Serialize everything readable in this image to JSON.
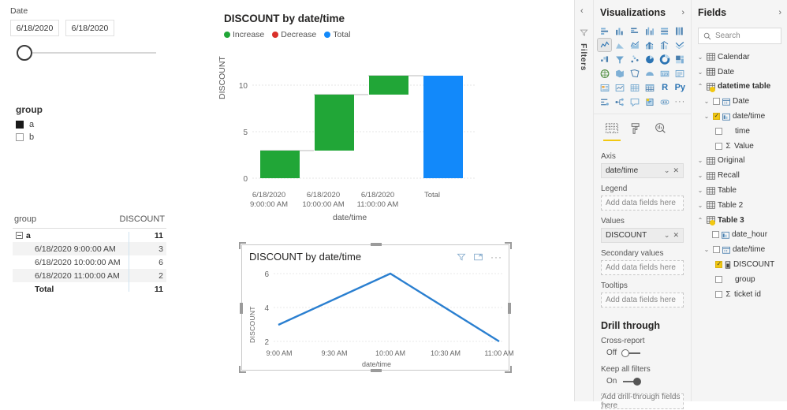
{
  "canvas": {
    "date_slicer": {
      "title": "Date",
      "start": "6/18/2020",
      "end": "6/18/2020"
    },
    "group_slicer": {
      "title": "group",
      "items": [
        {
          "label": "a",
          "checked": true
        },
        {
          "label": "b",
          "checked": false
        }
      ]
    },
    "matrix": {
      "columns": [
        "group",
        "DISCOUNT"
      ],
      "rows": [
        {
          "label": "a",
          "value": "11",
          "level": 0,
          "bold": true,
          "expander": true
        },
        {
          "label": "6/18/2020 9:00:00 AM",
          "value": "3",
          "level": 1,
          "bold": false,
          "expander": false
        },
        {
          "label": "6/18/2020 10:00:00 AM",
          "value": "6",
          "level": 1,
          "bold": false,
          "expander": false
        },
        {
          "label": "6/18/2020 11:00:00 AM",
          "value": "2",
          "level": 1,
          "bold": false,
          "expander": false
        },
        {
          "label": "Total",
          "value": "11",
          "level": 1,
          "bold": true,
          "expander": false
        }
      ]
    }
  },
  "chart_data": [
    {
      "type": "bar",
      "subtype": "waterfall",
      "title": "DISCOUNT by date/time",
      "xlabel": "date/time",
      "ylabel": "DISCOUNT",
      "ylim": [
        0,
        11
      ],
      "yticks": [
        "0",
        "5",
        "10"
      ],
      "grid": true,
      "legend": [
        {
          "label": "Increase",
          "color": "#21A637"
        },
        {
          "label": "Decrease",
          "color": "#D9302A"
        },
        {
          "label": "Total",
          "color": "#1289FA"
        }
      ],
      "categories": [
        "6/18/2020\n9:00:00 AM",
        "6/18/2020\n10:00:00 AM",
        "6/18/2020\n11:00:00 AM",
        "Total"
      ],
      "category_lines": [
        [
          "6/18/2020",
          "9:00:00 AM"
        ],
        [
          "6/18/2020",
          "10:00:00 AM"
        ],
        [
          "6/18/2020",
          "11:00:00 AM"
        ],
        [
          "Total",
          ""
        ]
      ],
      "bars": [
        {
          "category": "6/18/2020 9:00:00 AM",
          "base": 0,
          "top": 3,
          "delta": 3,
          "kind": "Increase",
          "color": "#21A637"
        },
        {
          "category": "6/18/2020 10:00:00 AM",
          "base": 3,
          "top": 9,
          "delta": 6,
          "kind": "Increase",
          "color": "#21A637"
        },
        {
          "category": "6/18/2020 11:00:00 AM",
          "base": 9,
          "top": 11,
          "delta": 2,
          "kind": "Increase",
          "color": "#21A637"
        },
        {
          "category": "Total",
          "base": 0,
          "top": 11,
          "delta": 11,
          "kind": "Total",
          "color": "#1289FA"
        }
      ]
    },
    {
      "type": "line",
      "title": "DISCOUNT by date/time",
      "xlabel": "date/time",
      "ylabel": "DISCOUNT",
      "ylim": [
        2,
        6
      ],
      "yticks": [
        "2",
        "4",
        "6"
      ],
      "xticks": [
        "9:00 AM",
        "9:30 AM",
        "10:00 AM",
        "10:30 AM",
        "11:00 AM"
      ],
      "grid": true,
      "line_color": "#2A7FD0",
      "series": [
        {
          "name": "DISCOUNT",
          "points": [
            {
              "x": "9:00 AM",
              "y": 3
            },
            {
              "x": "10:00 AM",
              "y": 6
            },
            {
              "x": "11:00 AM",
              "y": 2
            }
          ]
        }
      ],
      "header_icons": [
        "filter-icon",
        "focus-mode-icon",
        "more-options-icon"
      ]
    }
  ],
  "right_rail": {
    "filters_tab": {
      "label": "Filters",
      "icon": "filter-icon",
      "collapse_icon": "chevron-left-icon"
    },
    "visualizations": {
      "title": "Visualizations",
      "expand_icon": "chevron-right-icon",
      "icons": [
        "stacked-bar-chart-icon",
        "stacked-column-chart-icon",
        "clustered-bar-chart-icon",
        "clustered-column-chart-icon",
        "100-stacked-bar-chart-icon",
        "100-stacked-column-chart-icon",
        "line-chart-icon",
        "area-chart-icon",
        "stacked-area-chart-icon",
        "line-stacked-column-chart-icon",
        "line-clustered-column-chart-icon",
        "ribbon-chart-icon",
        "waterfall-chart-icon",
        "funnel-chart-icon",
        "scatter-chart-icon",
        "pie-chart-icon",
        "donut-chart-icon",
        "treemap-icon",
        "map-icon",
        "filled-map-icon",
        "shape-map-icon",
        "arcgis-map-icon",
        "gauge-icon",
        "card-icon",
        "multi-row-card-icon",
        "kpi-icon",
        "slicer-icon",
        "table-icon",
        "matrix-icon",
        "r-script-visual-icon",
        "py-script-visual-icon",
        "key-influencers-icon",
        "decomposition-tree-icon",
        "qa-icon",
        "smart-narrative-icon",
        "paginated-report-icon",
        "more-visuals-icon"
      ],
      "selected_icon": "line-chart-icon",
      "r_label": "R",
      "py_label": "Py",
      "tabs": [
        {
          "name": "fields-tab",
          "icon": "fields-grid-icon",
          "active": true
        },
        {
          "name": "format-tab",
          "icon": "paint-roller-icon",
          "active": false
        },
        {
          "name": "analytics-tab",
          "icon": "magnifier-chart-icon",
          "active": false
        }
      ],
      "wells": [
        {
          "label": "Axis",
          "value": "date/time",
          "filled": true,
          "placeholder": ""
        },
        {
          "label": "Legend",
          "value": "",
          "filled": false,
          "placeholder": "Add data fields here"
        },
        {
          "label": "Values",
          "value": "DISCOUNT",
          "filled": true,
          "placeholder": ""
        },
        {
          "label": "Secondary values",
          "value": "",
          "filled": false,
          "placeholder": "Add data fields here"
        },
        {
          "label": "Tooltips",
          "value": "",
          "filled": false,
          "placeholder": "Add data fields here"
        }
      ],
      "drill_through": {
        "title": "Drill through",
        "cross_report": {
          "label": "Cross-report",
          "state": "Off",
          "on": false
        },
        "keep_all_filters": {
          "label": "Keep all filters",
          "state": "On",
          "on": true
        },
        "drop_zone": "Add drill-through fields here"
      }
    },
    "fields": {
      "title": "Fields",
      "expand_icon": "chevron-right-icon",
      "search_placeholder": "Search",
      "search_icon": "search-icon",
      "tree": [
        {
          "label": "Calendar",
          "level": 0,
          "type": "table",
          "expanded": false,
          "checkbox": false,
          "checked": false,
          "bold": false
        },
        {
          "label": "Date",
          "level": 0,
          "type": "table",
          "expanded": false,
          "checkbox": false,
          "checked": false,
          "bold": false
        },
        {
          "label": "datetime table",
          "level": 0,
          "type": "table-key",
          "expanded": true,
          "checkbox": false,
          "checked": false,
          "bold": true
        },
        {
          "label": "Date",
          "level": 1,
          "type": "date-hierarchy",
          "expanded": false,
          "checkbox": true,
          "checked": false,
          "bold": false
        },
        {
          "label": "date/time",
          "level": 1,
          "type": "datetime-field",
          "expanded": false,
          "checkbox": true,
          "checked": true,
          "bold": false
        },
        {
          "label": "time",
          "level": 2,
          "type": "plain",
          "expanded": null,
          "checkbox": true,
          "checked": false,
          "bold": false
        },
        {
          "label": "Value",
          "level": 2,
          "type": "measure",
          "expanded": null,
          "checkbox": true,
          "checked": false,
          "bold": false
        },
        {
          "label": "Original",
          "level": 0,
          "type": "table",
          "expanded": false,
          "checkbox": false,
          "checked": false,
          "bold": false
        },
        {
          "label": "Recall",
          "level": 0,
          "type": "table",
          "expanded": false,
          "checkbox": false,
          "checked": false,
          "bold": false
        },
        {
          "label": "Table",
          "level": 0,
          "type": "table",
          "expanded": false,
          "checkbox": false,
          "checked": false,
          "bold": false
        },
        {
          "label": "Table 2",
          "level": 0,
          "type": "table",
          "expanded": false,
          "checkbox": false,
          "checked": false,
          "bold": false
        },
        {
          "label": "Table 3",
          "level": 0,
          "type": "table-key",
          "expanded": true,
          "checkbox": false,
          "checked": false,
          "bold": true
        },
        {
          "label": "date_hour",
          "level": 1,
          "type": "datetime-field",
          "expanded": null,
          "checkbox": true,
          "checked": false,
          "bold": false
        },
        {
          "label": "date/time",
          "level": 1,
          "type": "date-hierarchy",
          "expanded": false,
          "checkbox": true,
          "checked": false,
          "bold": false
        },
        {
          "label": "DISCOUNT",
          "level": 2,
          "type": "column",
          "expanded": null,
          "checkbox": true,
          "checked": true,
          "bold": false
        },
        {
          "label": "group",
          "level": 2,
          "type": "plain",
          "expanded": null,
          "checkbox": true,
          "checked": false,
          "bold": false
        },
        {
          "label": "ticket id",
          "level": 2,
          "type": "measure",
          "expanded": null,
          "checkbox": true,
          "checked": false,
          "bold": false
        }
      ]
    }
  }
}
